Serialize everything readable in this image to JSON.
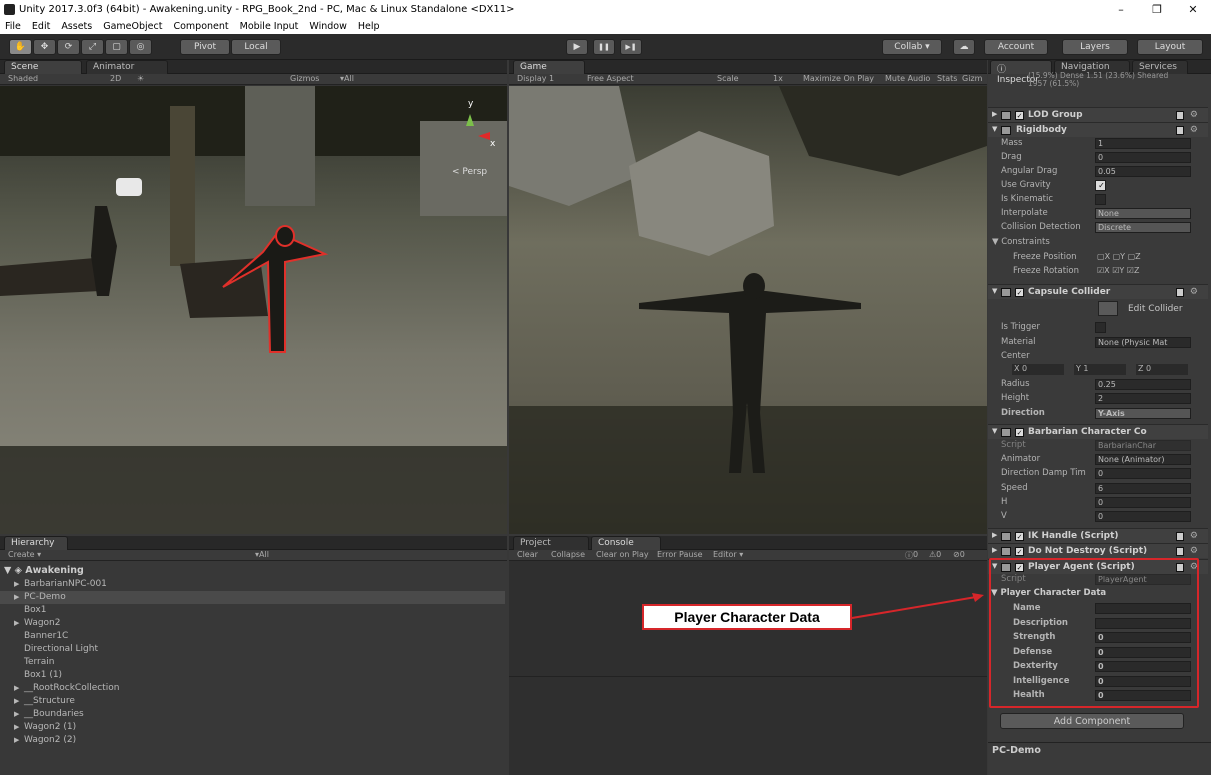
{
  "window": {
    "title": "Unity 2017.3.0f3 (64bit) - Awakening.unity - RPG_Book_2nd - PC, Mac & Linux Standalone <DX11>",
    "minimize": "–",
    "maximize": "❐",
    "close": "✕"
  },
  "menu": [
    "File",
    "Edit",
    "Assets",
    "GameObject",
    "Component",
    "Mobile Input",
    "Window",
    "Help"
  ],
  "toolbar": {
    "pivot": "Pivot",
    "local": "Local",
    "play": "▶",
    "pause": "❚❚",
    "step": "▶❚",
    "collab": "Collab ▾",
    "account": "Account",
    "layers": "Layers",
    "layout": "Layout"
  },
  "scene": {
    "tabs": [
      "Scene",
      "Animator"
    ],
    "shading": "Shaded",
    "mode2d": "2D",
    "gizmos": "Gizmos",
    "search": "▾All",
    "persp": "< Persp",
    "axis_y": "y",
    "axis_x": "x"
  },
  "game": {
    "tab": "Game",
    "display": "Display 1",
    "aspect": "Free Aspect",
    "scale_label": "Scale",
    "scale_value": "1x",
    "maximize": "Maximize On Play",
    "mute": "Mute Audio",
    "stats": "Stats",
    "gizmos": "Gizm"
  },
  "hierarchy": {
    "tab": "Hierarchy",
    "create": "Create ▾",
    "search": "▾All",
    "scene_name": "Awakening",
    "items": [
      {
        "label": "BarbarianNPC-001",
        "exp": "▶",
        "selected": false
      },
      {
        "label": "PC-Demo",
        "exp": "▶",
        "selected": true
      },
      {
        "label": "Box1",
        "exp": "",
        "selected": false
      },
      {
        "label": "Wagon2",
        "exp": "▶",
        "selected": false
      },
      {
        "label": "Banner1C",
        "exp": "",
        "selected": false
      },
      {
        "label": "Directional Light",
        "exp": "",
        "selected": false
      },
      {
        "label": "Terrain",
        "exp": "",
        "selected": false
      },
      {
        "label": "Box1 (1)",
        "exp": "",
        "selected": false
      },
      {
        "label": "__RootRockCollection",
        "exp": "▶",
        "selected": false
      },
      {
        "label": "__Structure",
        "exp": "▶",
        "selected": false
      },
      {
        "label": "__Boundaries",
        "exp": "▶",
        "selected": false
      },
      {
        "label": "Wagon2 (1)",
        "exp": "▶",
        "selected": false
      },
      {
        "label": "Wagon2 (2)",
        "exp": "▶",
        "selected": false
      }
    ]
  },
  "console": {
    "tabs": [
      "Project",
      "Console"
    ],
    "buttons": [
      "Clear",
      "Collapse",
      "Clear on Play",
      "Error Pause",
      "Editor ▾"
    ],
    "counts": [
      "0",
      "0",
      "0"
    ]
  },
  "inspector": {
    "tabs": [
      "Inspector",
      "Navigation",
      "Services"
    ],
    "top_text": "(15.9%) Dense 1.51 (23.6%) Sheared",
    "top_text2": "1957 (61.5%)",
    "lod_group": "LOD Group",
    "rigidbody": {
      "title": "Rigidbody",
      "rows": [
        {
          "label": "Mass",
          "value": "1"
        },
        {
          "label": "Drag",
          "value": "0"
        },
        {
          "label": "Angular Drag",
          "value": "0.05"
        },
        {
          "label": "Use Gravity",
          "value": "✓"
        },
        {
          "label": "Is Kinematic",
          "value": ""
        },
        {
          "label": "Interpolate",
          "value": "None"
        },
        {
          "label": "Collision Detection",
          "value": "Discrete"
        }
      ],
      "constraints": "Constraints",
      "freeze_pos": "Freeze Position",
      "freeze_rot": "Freeze Rotation",
      "x": "X",
      "y": "Y",
      "z": "Z"
    },
    "capsule": {
      "title": "Capsule Collider",
      "edit": "Edit Collider",
      "is_trigger": "Is Trigger",
      "material_label": "Material",
      "material_value": "None (Physic Mat",
      "center": "Center",
      "cx": "X 0",
      "cy": "Y 1",
      "cz": "Z 0",
      "radius_label": "Radius",
      "radius": "0.25",
      "height_label": "Height",
      "height": "2",
      "direction_label": "Direction",
      "direction": "Y-Axis"
    },
    "barbarian": {
      "title": "Barbarian Character Co",
      "rows": [
        {
          "label": "Script",
          "value": "BarbarianChar"
        },
        {
          "label": "Animator",
          "value": "None (Animator)"
        },
        {
          "label": "Direction Damp Tim",
          "value": "0"
        },
        {
          "label": "Speed",
          "value": "6"
        },
        {
          "label": "H",
          "value": "0"
        },
        {
          "label": "V",
          "value": "0"
        }
      ]
    },
    "ik_handle": "IK Handle (Script)",
    "dont_destroy": "Do Not Destroy (Script)",
    "player_agent": {
      "title": "Player Agent (Script)",
      "script_label": "Script",
      "script_value": "PlayerAgent",
      "data_header": "Player Character Data",
      "rows": [
        {
          "label": "Name",
          "value": ""
        },
        {
          "label": "Description",
          "value": ""
        },
        {
          "label": "Strength",
          "value": "0"
        },
        {
          "label": "Defense",
          "value": "0"
        },
        {
          "label": "Dexterity",
          "value": "0"
        },
        {
          "label": "Intelligence",
          "value": "0"
        },
        {
          "label": "Health",
          "value": "0"
        }
      ]
    },
    "add_component": "Add Component",
    "footer": "PC-Demo"
  },
  "annotation": {
    "callout": "Player Character Data",
    "color": "#d6262a"
  }
}
